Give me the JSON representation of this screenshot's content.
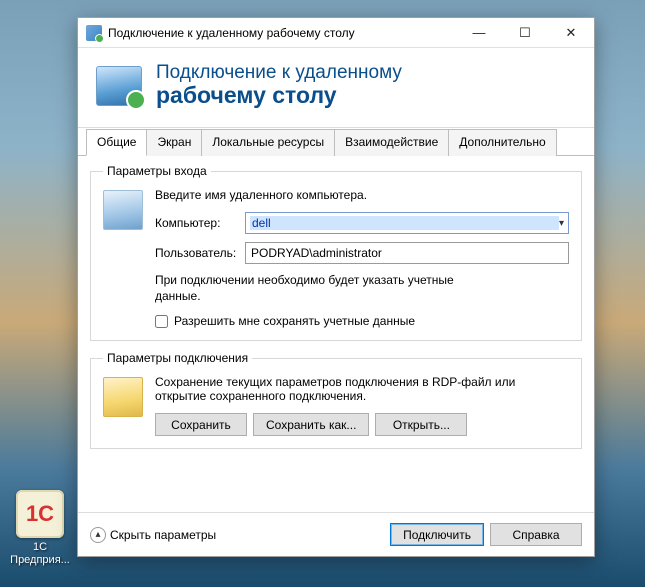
{
  "desktop": {
    "icon_label": "1С",
    "label_line1": "1С",
    "label_line2": "Предприя..."
  },
  "window": {
    "title": "Подключение к удаленному рабочему столу"
  },
  "banner": {
    "line1": "Подключение к удаленному",
    "line2": "рабочему столу"
  },
  "tabs": [
    {
      "label": "Общие",
      "active": true
    },
    {
      "label": "Экран",
      "active": false
    },
    {
      "label": "Локальные ресурсы",
      "active": false
    },
    {
      "label": "Взаимодействие",
      "active": false
    },
    {
      "label": "Дополнительно",
      "active": false
    }
  ],
  "login": {
    "legend": "Параметры входа",
    "intro": "Введите имя удаленного компьютера.",
    "computer_label": "Компьютер:",
    "computer_value": "dell",
    "user_label": "Пользователь:",
    "user_value": "PODRYAD\\administrator",
    "note": "При подключении необходимо будет указать учетные данные.",
    "allow_save_label": "Разрешить мне сохранять учетные данные",
    "allow_save_checked": false
  },
  "conn": {
    "legend": "Параметры подключения",
    "intro": "Сохранение текущих параметров подключения в RDP-файл или открытие сохраненного подключения.",
    "save": "Сохранить",
    "save_as": "Сохранить как...",
    "open": "Открыть..."
  },
  "footer": {
    "hide": "Скрыть параметры",
    "connect": "Подключить",
    "help": "Справка"
  }
}
